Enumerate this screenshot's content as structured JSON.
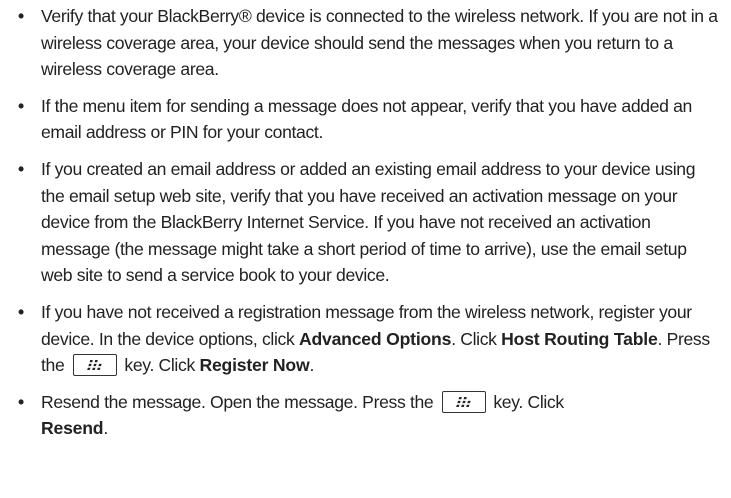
{
  "bullet_char": "•",
  "items": [
    {
      "text": "Verify that your BlackBerry® device is connected to the wireless network. If you are not in a wireless coverage area, your device should send the messages when you return to a wireless coverage area."
    },
    {
      "text": "If the menu item for sending a message does not appear, verify that you have added an email address or PIN for your contact."
    },
    {
      "text": "If you created an email address or added an existing email address to your device using the email setup web site, verify that you have received an activation message on your device from the BlackBerry Internet Service. If you have not received an activation message (the message might take a short period of time to arrive), use the email setup web site to send a service book to your device."
    },
    {
      "part1": "If you have not received a registration message from the wireless network, register your device. In the device options, click ",
      "bold1": "Advanced Options",
      "part2": ". Click ",
      "bold2": "Host Routing Table",
      "part3": ". Press the",
      "key_icon": "blackberry-menu-key-icon",
      "part4": "key. Click ",
      "bold3": "Register Now",
      "part5": "."
    },
    {
      "part1": "Resend the message. Open the message. Press the",
      "key_icon": "blackberry-menu-key-icon",
      "part2": "key. Click ",
      "bold1": "Resend",
      "part3": "."
    }
  ]
}
